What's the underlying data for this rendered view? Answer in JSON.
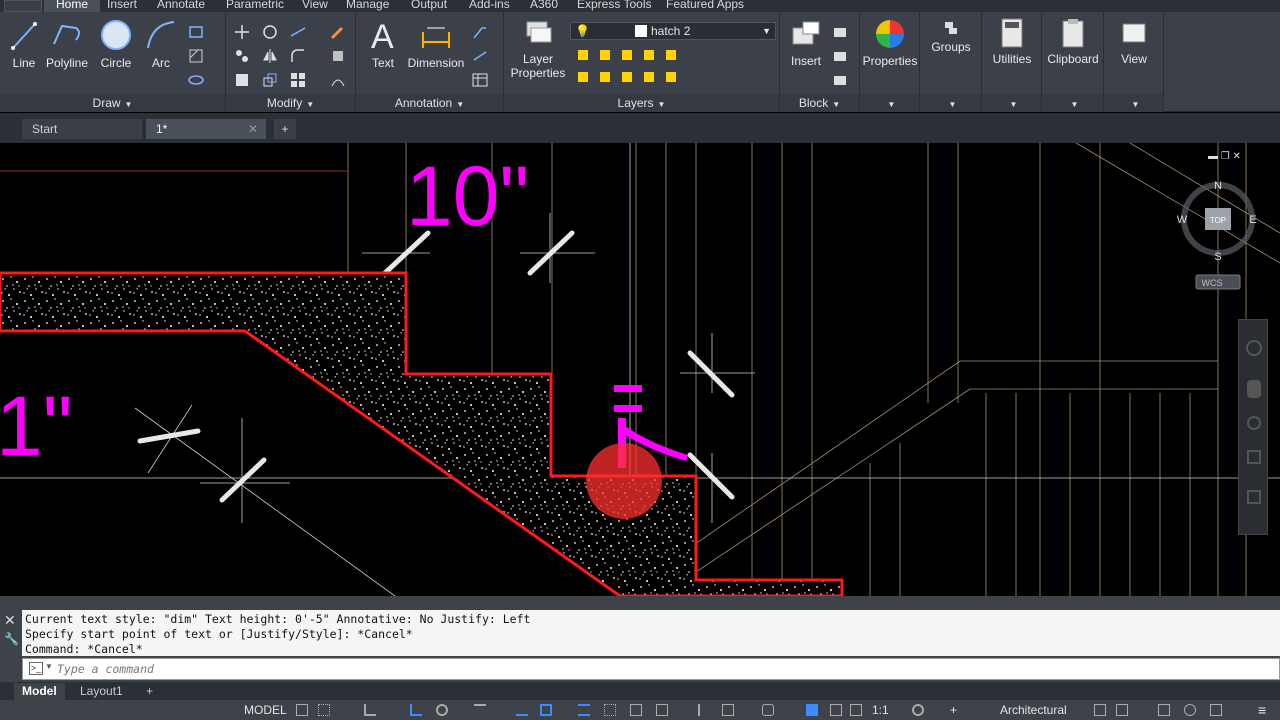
{
  "ribbon_tabs": [
    "Home",
    "Insert",
    "Annotate",
    "Parametric",
    "View",
    "Manage",
    "Output",
    "Add-ins",
    "A360",
    "Express Tools",
    "Featured Apps"
  ],
  "ribbon": {
    "draw": {
      "line": "Line",
      "polyline": "Polyline",
      "circle": "Circle",
      "arc": "Arc",
      "title": "Draw"
    },
    "modify": {
      "title": "Modify"
    },
    "annotation": {
      "text": "Text",
      "dimension": "Dimension",
      "title": "Annotation"
    },
    "layers": {
      "layer_properties_1": "Layer",
      "layer_properties_2": "Properties",
      "current_layer": "hatch 2",
      "title": "Layers"
    },
    "block": {
      "insert": "Insert",
      "title": "Block"
    },
    "properties": {
      "label": "Properties"
    },
    "groups": {
      "label": "Groups"
    },
    "utilities": {
      "label": "Utilities"
    },
    "clipboard": {
      "label": "Clipboard"
    },
    "view": {
      "label": "View"
    }
  },
  "file_tabs": {
    "start": "Start",
    "current": "1*"
  },
  "drawing": {
    "dim_text_1": "10\"",
    "dim_text_2": "1\"",
    "viewcube": {
      "n": "N",
      "s": "S",
      "e": "E",
      "w": "W",
      "top": "TOP",
      "wcs": "WCS"
    }
  },
  "command": {
    "history": [
      "Current text style:  \"dim\"  Text height:  0'-5\"  Annotative:  No  Justify:  Left",
      "Specify start point of text or [Justify/Style]: *Cancel*",
      "Command: *Cancel*"
    ],
    "placeholder": "Type a command"
  },
  "layout_tabs": {
    "model": "Model",
    "layout1": "Layout1"
  },
  "status_bar": {
    "model": "MODEL",
    "scale": "1:1",
    "units": "Architectural"
  },
  "colors": {
    "magenta": "#ff00ff",
    "red": "#ff1a1a",
    "line_tan": "#c8b48c",
    "ribbon": "#3b4049"
  }
}
